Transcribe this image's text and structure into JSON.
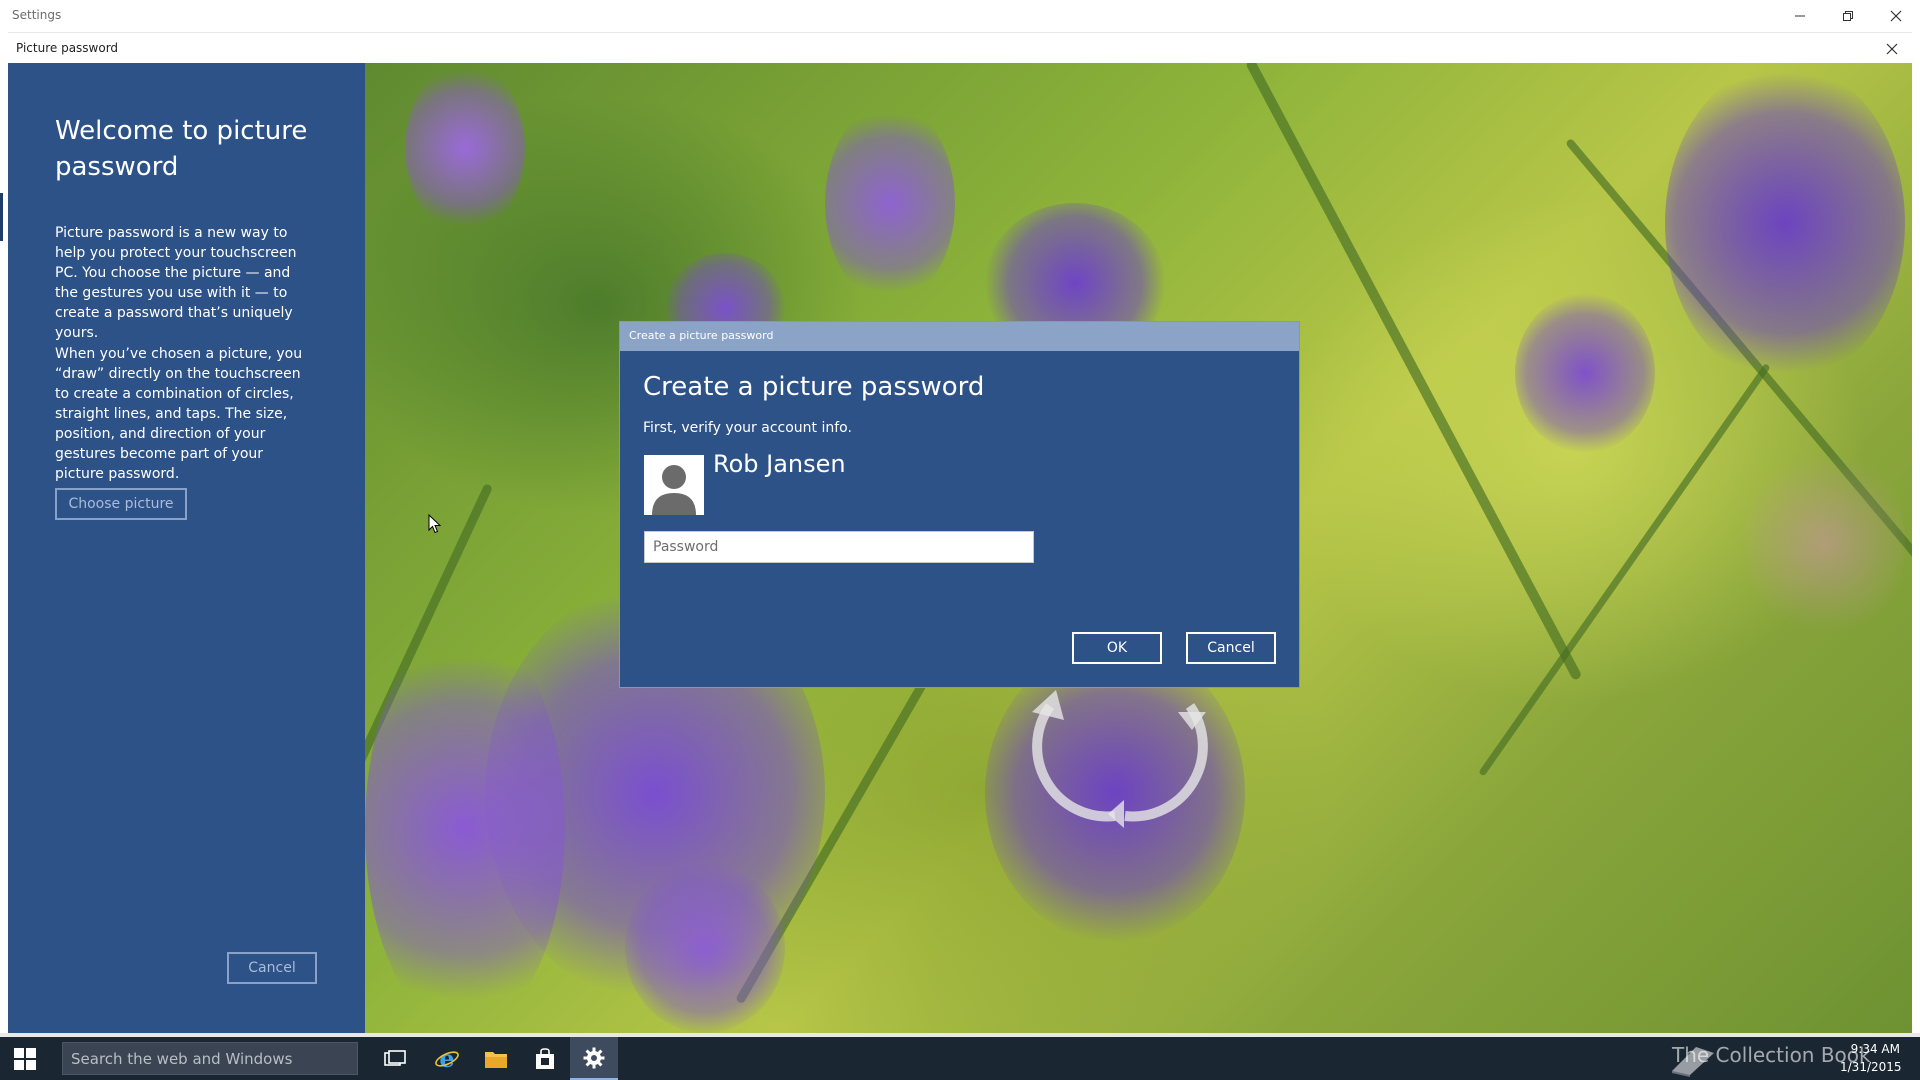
{
  "settings_window": {
    "title": "Settings"
  },
  "picture_password_window": {
    "title": "Picture password"
  },
  "left_panel": {
    "heading": "Welcome to picture password",
    "paragraph_1": "Picture password is a new way to help you protect your touchscreen PC. You choose the picture — and the gestures you use with it — to create a password that’s uniquely yours.",
    "paragraph_2": "When you’ve chosen a picture, you “draw” directly on the touchscreen to create a combination of circles, straight lines, and taps. The size, position, and direction of your gestures become part of your picture password.",
    "choose_picture_label": "Choose picture",
    "cancel_label": "Cancel"
  },
  "dialog": {
    "titlebar": "Create a picture password",
    "heading": "Create a picture password",
    "subtitle": "First, verify your account info.",
    "user_name": "Rob Jansen",
    "password_placeholder": "Password",
    "password_value": "",
    "ok_label": "OK",
    "cancel_label": "Cancel"
  },
  "taskbar": {
    "search_placeholder": "Search the web and Windows",
    "time": "9:34 AM",
    "date": "1/31/2015",
    "watermark": "The Collection Book"
  },
  "colors": {
    "panel_blue": "#2d5288",
    "dialog_titlebar": "#8aa3c7",
    "taskbar": "#1b2633"
  },
  "icons": [
    "windows-start-icon",
    "task-view-icon",
    "internet-explorer-icon",
    "file-explorer-icon",
    "store-icon",
    "settings-gear-icon",
    "user-avatar-icon",
    "minimize-icon",
    "restore-icon",
    "close-icon"
  ]
}
